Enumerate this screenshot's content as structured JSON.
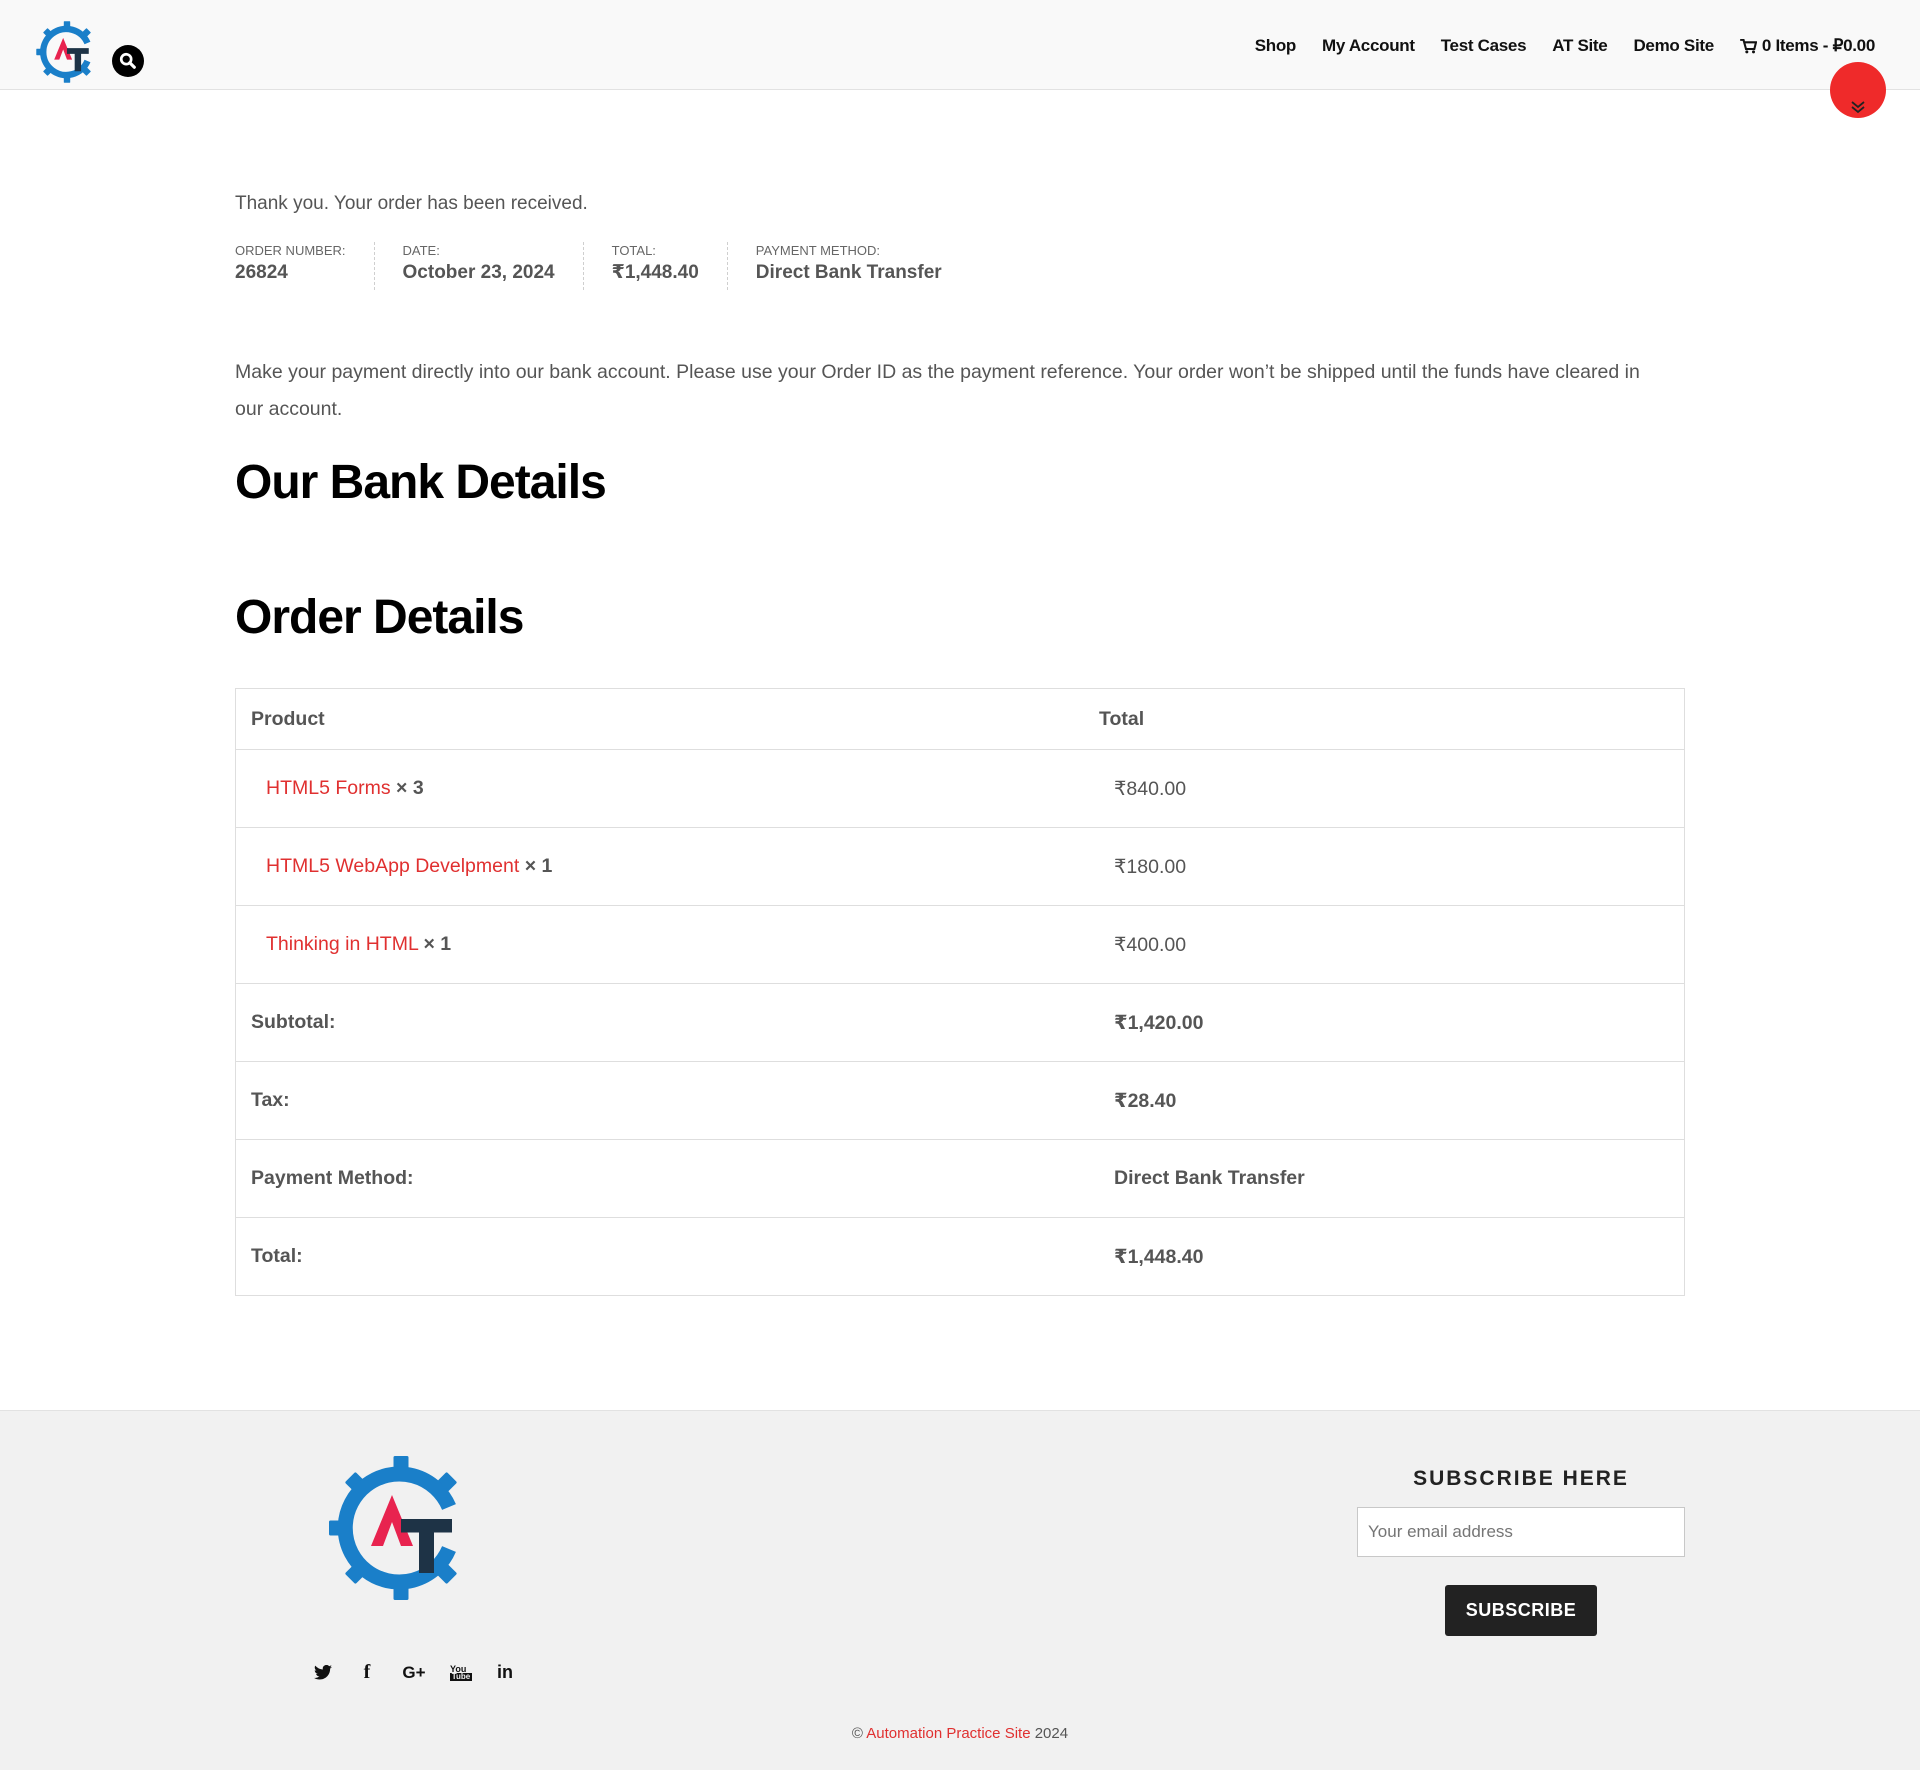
{
  "header": {
    "logo_alt": "AT",
    "search_icon": "search-icon",
    "nav": [
      {
        "label": "Shop"
      },
      {
        "label": "My Account"
      },
      {
        "label": "Test Cases"
      },
      {
        "label": "AT Site"
      },
      {
        "label": "Demo Site"
      }
    ],
    "cart_label": "0 Items - ₽0.00",
    "cart_icon": "cart-icon"
  },
  "scroll_button_icon": "chevron-double-down-icon",
  "order": {
    "thank_you": "Thank you. Your order has been received.",
    "overview": [
      {
        "label": "Order number:",
        "value": "26824"
      },
      {
        "label": "Date:",
        "value": "October 23, 2024"
      },
      {
        "label": "Total:",
        "value": "₹1,448.40"
      },
      {
        "label": "Payment method:",
        "value": "Direct Bank Transfer"
      }
    ],
    "payment_instructions": "Make your payment directly into our bank account. Please use your Order ID as the payment reference. Your order won’t be shipped until the funds have cleared in our account.",
    "bank_heading": "Our Bank Details",
    "details_heading": "Order Details",
    "table": {
      "headers": {
        "product": "Product",
        "total": "Total"
      },
      "items": [
        {
          "name": "HTML5 Forms",
          "qty": "× 3",
          "total": "₹840.00"
        },
        {
          "name": "HTML5 WebApp Develpment",
          "qty": "× 1",
          "total": "₹180.00"
        },
        {
          "name": "Thinking in HTML",
          "qty": "× 1",
          "total": "₹400.00"
        }
      ],
      "totals": [
        {
          "label": "Subtotal:",
          "value": "₹1,420.00"
        },
        {
          "label": "Tax:",
          "value": "₹28.40"
        },
        {
          "label": "Payment Method:",
          "value": "Direct Bank Transfer"
        },
        {
          "label": "Total:",
          "value": "₹1,448.40"
        }
      ]
    }
  },
  "footer": {
    "subscribe_title": "SUBSCRIBE HERE",
    "email_placeholder": "Your email address",
    "subscribe_button": "SUBSCRIBE",
    "social": [
      {
        "icon": "twitter-icon",
        "glyph": "🐦"
      },
      {
        "icon": "facebook-icon",
        "glyph": "f"
      },
      {
        "icon": "google-plus-icon",
        "glyph": "G+"
      },
      {
        "icon": "youtube-icon",
        "glyph": "You"
      },
      {
        "icon": "linkedin-icon",
        "glyph": "in"
      }
    ],
    "copyright_prefix": "©",
    "copyright_link": "Automation Practice Site",
    "copyright_year": "2024"
  },
  "colors": {
    "accent": "#e03030",
    "scroll_button": "#ef2a2a",
    "logo_blue": "#1a7fc9",
    "logo_red": "#e8234f",
    "logo_dark": "#1e3346"
  }
}
